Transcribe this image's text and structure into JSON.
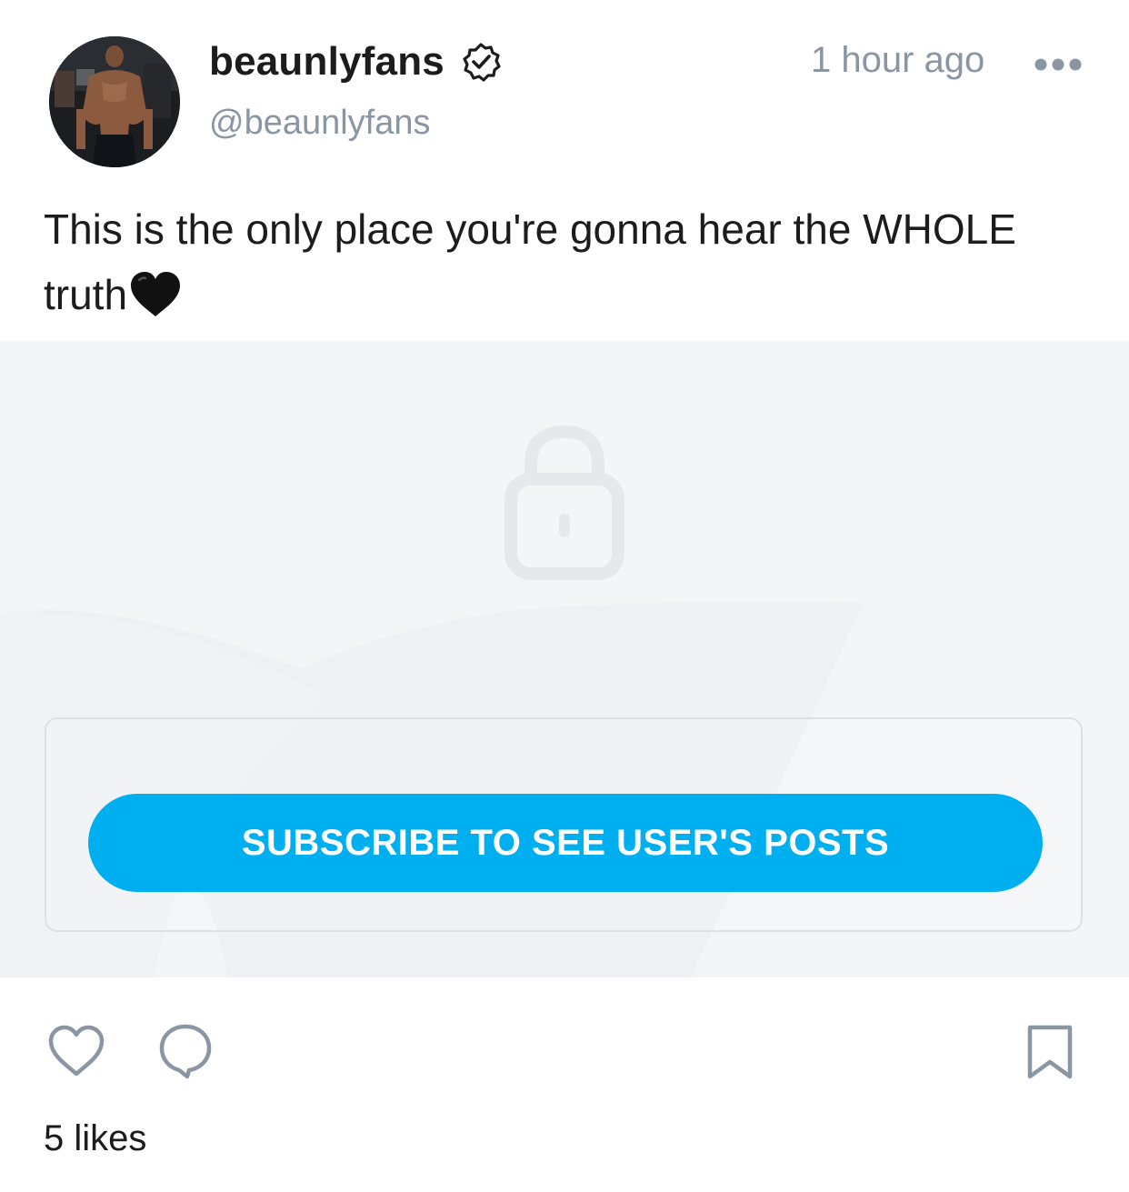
{
  "post": {
    "author": {
      "display_name": "beaunlyfans",
      "handle": "@beaunlyfans",
      "verified": true
    },
    "timestamp": "1 hour ago",
    "caption": "This is the only place you're gonna hear the WHOLE truth",
    "caption_emoji": "black-heart",
    "locked": true,
    "subscribe_label": "SUBSCRIBE TO SEE USER'S POSTS",
    "likes": "5 likes"
  },
  "colors": {
    "accent": "#00aff0",
    "muted_text": "#8a96a3",
    "locked_bg": "#f4f5f7"
  },
  "icons": {
    "more": "more-horizontal-icon",
    "verified": "verified-badge-icon",
    "lock": "lock-icon",
    "like": "heart-icon",
    "comment": "comment-icon",
    "bookmark": "bookmark-icon"
  }
}
